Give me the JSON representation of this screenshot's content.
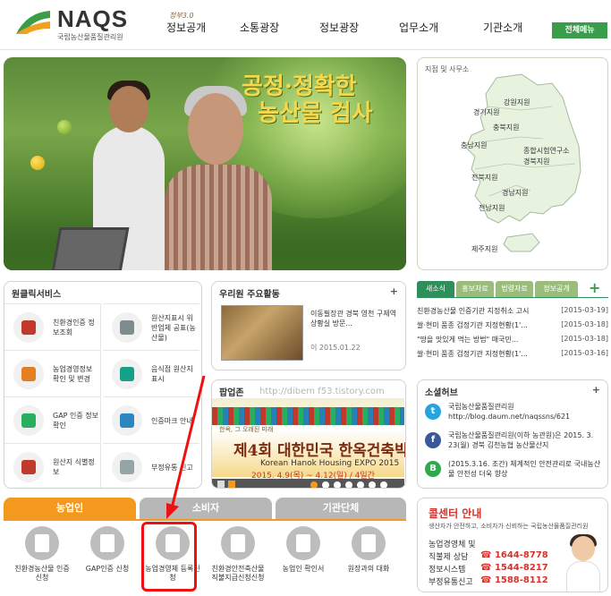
{
  "header": {
    "logo_word": "NAQS",
    "logo_sub": "국립농산물품질관리원",
    "nav_sup": "정부3.0",
    "nav": [
      "정보공개",
      "소통광장",
      "정보광장",
      "업무소개",
      "기관소개"
    ],
    "all_menu": "전체메뉴"
  },
  "banner": {
    "line1": "공정·정확한",
    "line2": "농산물 검사",
    "slides": 9,
    "active_slide": 1
  },
  "map": {
    "title": "지점 및 사무소",
    "branches": [
      "강원지원",
      "경기지원",
      "충북지원",
      "충남지원",
      "경북지원",
      "전북지원",
      "경남지원",
      "전남지원",
      "제주지원"
    ],
    "special": "종합시험연구소",
    "special2": "경북지원"
  },
  "one_click": {
    "title": "원클릭서비스",
    "items": [
      {
        "label": "친환경인증 정보조회",
        "icon": "certificate-icon"
      },
      {
        "label": "원산지표시 위반업체 공표(농산물)",
        "icon": "no-sign-icon"
      },
      {
        "label": "농업경영정보 확인 및 변경",
        "icon": "pencil-icon"
      },
      {
        "label": "음식점 원산지 표시",
        "icon": "menu-board-icon"
      },
      {
        "label": "GAP 인증 정보확인",
        "icon": "gap-mark-icon"
      },
      {
        "label": "인증마크 안내",
        "icon": "mark-icon"
      },
      {
        "label": "원산지 식별정보",
        "icon": "checklist-icon"
      },
      {
        "label": "부정유통 신고",
        "icon": "report-icon"
      }
    ]
  },
  "activity": {
    "title": "우리원 주요활동",
    "plus": "+",
    "text": "이동필장관 경북 영천 구제역 상황실 방문...",
    "date": "이 2015.01.22"
  },
  "popup": {
    "title": "팝업존",
    "watermark": "http://dibem f53.tistory.com",
    "tagline": "한옥, 그 오래된 미래",
    "event": "제4회 대한민국 한옥건축박람회",
    "event_en": "Korean Hanok Housing EXPO 2015",
    "dates": "2015. 4.9(목) ~ 4.12(일) / 4일간"
  },
  "news": {
    "tabs": [
      "새소식",
      "홍보자료",
      "법령자료",
      "정보공개"
    ],
    "active_tab": 0,
    "rows": [
      {
        "title": "친환경농산물 인증기관 지정취소 고시",
        "date": "[2015-03-19]"
      },
      {
        "title": "쌀·현미 품종 검정기관 지정현황(1'...",
        "date": "[2015-03-18]"
      },
      {
        "title": "\"땅을 맛있게 먹는 방법\" 매국민...",
        "date": "[2015-03-18]"
      },
      {
        "title": "쌀·현미 품종 검정기관 지정현황(1'...",
        "date": "[2015-03-16]"
      }
    ]
  },
  "social": {
    "title": "소셜허브",
    "plus": "+",
    "items": [
      {
        "kind": "twitter",
        "glyph": "t",
        "color": "#27a4dd",
        "text": "국립농산물품질관리원 http://blog.daum.net/naqssns/621"
      },
      {
        "kind": "facebook",
        "glyph": "f",
        "color": "#3b5998",
        "text": "국립농산물품질관리원(이하 농관원)은 2015. 3. 23(월) 경북 김천농협 농산물산지"
      },
      {
        "kind": "blog",
        "glyph": "B",
        "color": "#2fa84f",
        "text": "(2015.3.16. 조간) 체계적인 안전관리로 국내농산물 안전성 더욱 향상"
      }
    ]
  },
  "bottom_tabs": {
    "tabs": [
      "농업인",
      "소비자",
      "기관단체"
    ],
    "active_tab": 0,
    "farmer_items": [
      {
        "label": "친환경농산물 인증 신청",
        "icon": "organic-cert-icon"
      },
      {
        "label": "GAP인증 신청",
        "icon": "gap-cert-icon"
      },
      {
        "label": "농업경영체 등록신청",
        "icon": "registration-form-icon"
      },
      {
        "label": "친환경안전축산물 직불지급신청신청",
        "icon": "document-icon"
      },
      {
        "label": "농업인 확인서",
        "icon": "farmer-id-icon"
      },
      {
        "label": "원장과의 대화",
        "icon": "speech-bubble-icon"
      }
    ]
  },
  "call_center": {
    "title": "콜센터 안내",
    "subtitle": "생산자가 안전하고, 소비자가 신뢰하는 국립농산물품질관리원",
    "rows": [
      {
        "label": "농업경영체 및",
        "phone": ""
      },
      {
        "label": "직불제 상담",
        "phone": "☎ 1644-8778"
      },
      {
        "label": "정보시스템",
        "phone": "☎ 1544-8217"
      },
      {
        "label": "부정유통신고",
        "phone": "☎ 1588-8112"
      }
    ]
  },
  "colors": {
    "green": "#3a9d4b",
    "news_green": "#2f8f5a",
    "tab_orange": "#f39a1e",
    "tab_gray": "#b7b7b7",
    "highlight_red": "#e11111"
  }
}
